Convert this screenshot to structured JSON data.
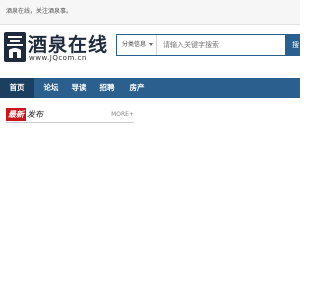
{
  "topbar": {
    "text": "酒泉在线，关注酒泉事。"
  },
  "logo": {
    "title": "酒泉在线",
    "url": "www.JQcom.cn",
    "icon": "building-icon"
  },
  "search": {
    "category": "分类信息",
    "placeholder": "请输入关键字搜索",
    "button_label": "搜"
  },
  "nav": {
    "items": [
      {
        "label": "首页",
        "active": true
      },
      {
        "label": "论坛"
      },
      {
        "label": "导读"
      },
      {
        "label": "招聘"
      },
      {
        "label": "房产"
      }
    ]
  },
  "section": {
    "badge": "最新",
    "title": "发布",
    "more": "MORE+"
  },
  "colors": {
    "brand": "#2b5f8e",
    "nav_active": "#1b3f60",
    "badge": "#c8161d"
  }
}
